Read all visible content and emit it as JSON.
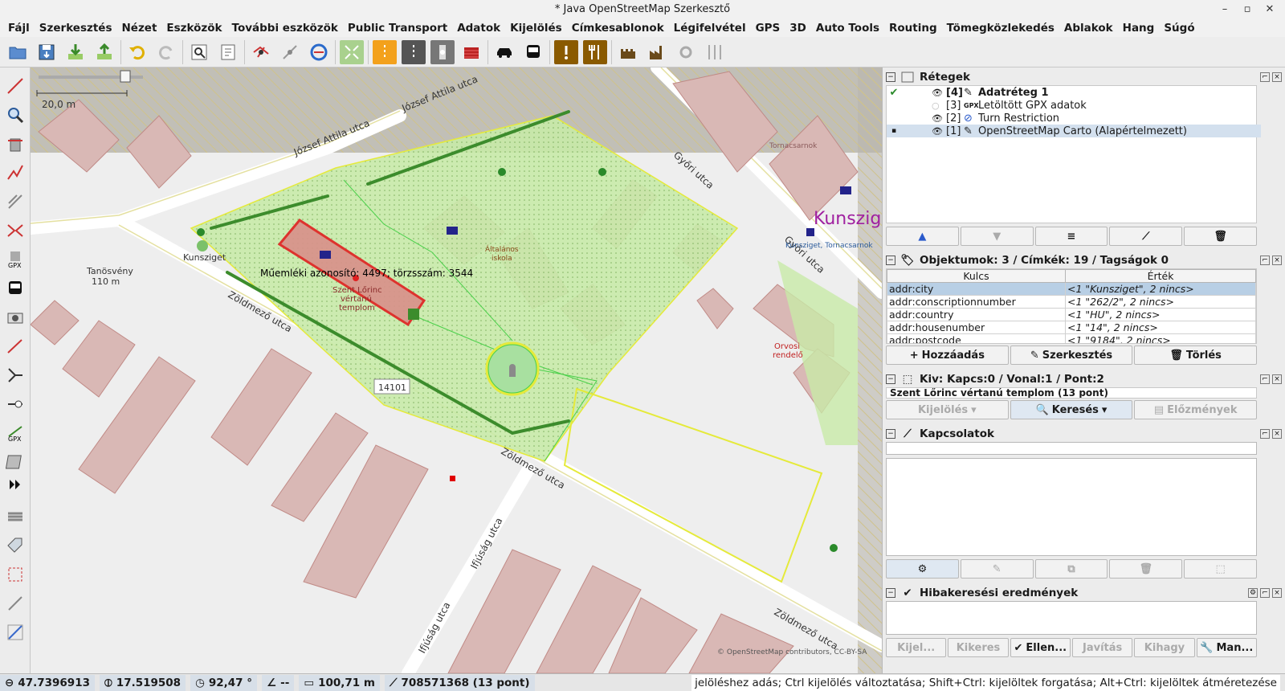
{
  "window": {
    "title": "* Java OpenStreetMap Szerkesztő",
    "controls": [
      "–",
      "▫",
      "✕"
    ]
  },
  "menu": [
    "Fájl",
    "Szerkesztés",
    "Nézet",
    "Eszközök",
    "További eszközök",
    "Public Transport",
    "Adatok",
    "Kijelölés",
    "Címkesablonok",
    "Légifelvétel",
    "GPS",
    "3D",
    "Auto Tools",
    "Routing",
    "Tömegközlekedés",
    "Ablakok",
    "Hang",
    "Súgó"
  ],
  "toolbar_icons": [
    "open-file-icon",
    "save-icon",
    "download-icon",
    "upload-icon",
    "undo-icon",
    "redo-icon",
    "preferences-icon",
    "zoom-to-data-icon",
    "relation-icon",
    "way-icon",
    "refresh-icon",
    "imagery-icon",
    "highway-icon",
    "road-icon",
    "traffic-signals-icon",
    "building-icon",
    "car-icon",
    "bus-icon",
    "exclamation-icon",
    "restaurant-icon",
    "castle-icon",
    "factory-icon",
    "gear-icon",
    "tools-icon"
  ],
  "map": {
    "scale_label": "20,0 m",
    "street_labels": [
      "József Attila utca",
      "József Attila utca",
      "Győri utca",
      "Győri utca",
      "Zöldmező utca",
      "Zöldmező utca",
      "Zöldmező utca",
      "Ifjúság utca",
      "Ifjúság utca"
    ],
    "place_label": "Kunszig",
    "poi_labels": {
      "kunsziget": "Kunsziget",
      "tanosveny": "Tanösvény",
      "tanosveny_dist": "110 m",
      "church1": "Szent Lőrinc",
      "church2": "vértanú",
      "church3": "templom",
      "school1": "Általános",
      "school2": "iskola",
      "orvosi1": "Orvosi",
      "orvosi2": "rendelő",
      "house_no": "14101",
      "tornacsarnok": "Tornacsarnok",
      "kunsziget_torn": "Kunsziget, Tornacsarnok"
    },
    "monument_label": "Műemléki azonosító: 4497; törzsszám: 3544",
    "attribution": "© OpenStreetMap contributors, CC-BY-SA"
  },
  "layers": {
    "title": "Rétegek",
    "items": [
      {
        "index": "[4]",
        "name": "Adatréteg 1",
        "bold": true
      },
      {
        "index": "[3]",
        "name": "Letöltött GPX adatok",
        "bold": false
      },
      {
        "index": "[2]",
        "name": "Turn Restriction",
        "bold": false
      },
      {
        "index": "[1]",
        "name": "OpenStreetMap Carto (Alapértelmezett)",
        "bold": false
      }
    ]
  },
  "tags": {
    "title": "Objektumok: 3 / Címkék: 19 / Tagságok 0",
    "col_key": "Kulcs",
    "col_value": "Érték",
    "rows": [
      {
        "k": "addr:city",
        "v": "<1 \"Kunsziget\", 2 nincs>"
      },
      {
        "k": "addr:conscriptionnumber",
        "v": "<1 \"262/2\", 2 nincs>"
      },
      {
        "k": "addr:country",
        "v": "<1 \"HU\", 2 nincs>"
      },
      {
        "k": "addr:housenumber",
        "v": "<1 \"14\", 2 nincs>"
      },
      {
        "k": "addr:postcode",
        "v": "<1 \"9184\", 2 nincs>"
      }
    ],
    "add": "Hozzáadás",
    "edit": "Szerkesztés",
    "delete": "Törlés"
  },
  "selection": {
    "title": "Kiv: Kapcs:0 / Vonal:1 / Pont:2",
    "item": "Szent Lőrinc vértanú templom (13 pont)",
    "select": "Kijelölés",
    "search": "Keresés",
    "history": "Előzmények"
  },
  "relations": {
    "title": "Kapcsolatok"
  },
  "validation": {
    "title": "Hibakeresési eredmények",
    "buttons": [
      "Kijel...",
      "Kikeres",
      "Ellen...",
      "Javítás",
      "Kihagy",
      "Man..."
    ]
  },
  "status": {
    "lat": "47.7396913",
    "lon": "17.519508",
    "heading": "92,47 °",
    "angle": "--",
    "distance": "100,71 m",
    "way": "708571368 (13 pont)",
    "hint": "jelöléshez adás; Ctrl kijelölés változtatása; Shift+Ctrl: kijelöltek forgatása; Alt+Ctrl: kijelöltek átméretezése"
  },
  "colors": {
    "accent": "#d32f2f",
    "park": "#c8eaa8",
    "building": "#d9b8b5",
    "selected": "#b8cfe5"
  }
}
